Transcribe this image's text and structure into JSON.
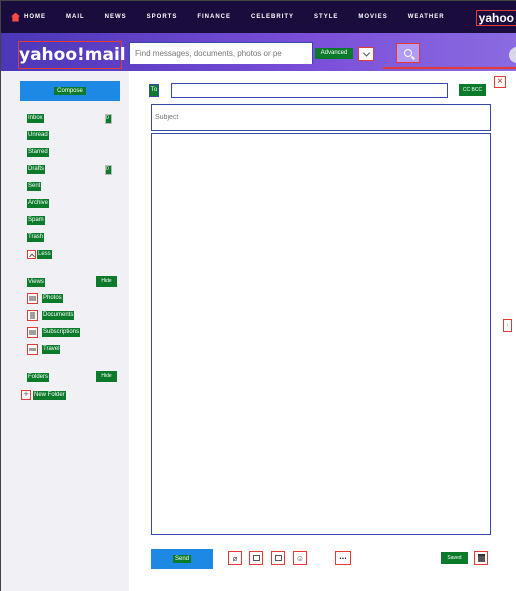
{
  "topnav": {
    "items": [
      "HOME",
      "MAIL",
      "NEWS",
      "SPORTS",
      "FINANCE",
      "CELEBRITY",
      "STYLE",
      "MOVIES",
      "WEATHER"
    ],
    "brand": "yahoo"
  },
  "header": {
    "logo": "yahoo!mail",
    "search_placeholder": "Find messages, documents, photos or pe",
    "advanced_label": "Advanced"
  },
  "sidebar": {
    "compose_label": "Compose",
    "folders": [
      {
        "label": "Inbox",
        "count": "0"
      },
      {
        "label": "Unread",
        "count": ""
      },
      {
        "label": "Starred",
        "count": ""
      },
      {
        "label": "Drafts",
        "count": "0"
      },
      {
        "label": "Sent",
        "count": ""
      },
      {
        "label": "Archive",
        "count": ""
      },
      {
        "label": "Spam",
        "count": ""
      },
      {
        "label": "Trash",
        "count": ""
      }
    ],
    "less_label": "Less",
    "views_label": "Views",
    "views_action": "Hide",
    "views": [
      {
        "label": "Photos",
        "icon": "photo-icon"
      },
      {
        "label": "Documents",
        "icon": "document-icon"
      },
      {
        "label": "Subscriptions",
        "icon": "newsletter-icon"
      },
      {
        "label": "Travel",
        "icon": "plane-icon"
      }
    ],
    "folders_label": "Folders",
    "folders_action": "Hide",
    "new_folder_label": "New Folder"
  },
  "compose": {
    "to_label": "To",
    "cc_bcc_label": "CC BCC",
    "subject_placeholder": "Subject",
    "send_label": "Send",
    "saved_label": "Saved",
    "more_label": "..."
  },
  "colors": {
    "topnav_bg": "#1a0c3c",
    "header_gradient_start": "#4b37b8",
    "accent_blue": "#1e88e5"
  }
}
